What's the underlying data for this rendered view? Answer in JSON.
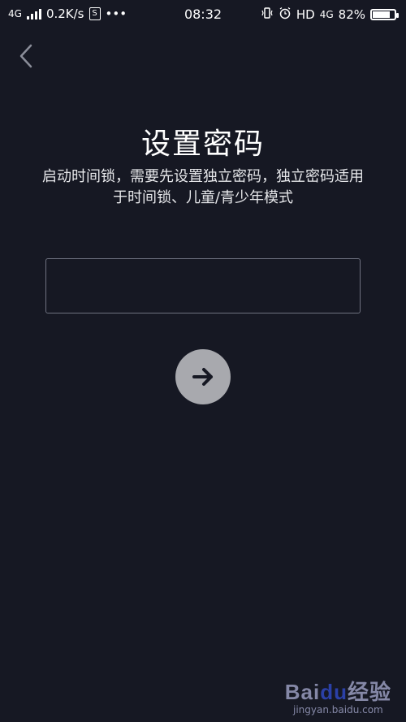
{
  "status_bar": {
    "network_type": "4G",
    "speed": "0.2K/s",
    "sim_label": "S",
    "more": "•••",
    "time": "08:32",
    "hd": "HD",
    "network_type_right": "4G",
    "battery_percent": "82%",
    "battery_level": 0.82
  },
  "page": {
    "title": "设置密码",
    "subtitle": "启动时间锁，需要先设置独立密码，独立密码适用于时间锁、儿童/青少年模式",
    "input_value": "",
    "input_placeholder": ""
  },
  "icons": {
    "back": "chevron-left-icon",
    "next": "arrow-right-icon",
    "vibrate": "vibrate-icon",
    "alarm": "alarm-icon"
  },
  "watermark": {
    "brand_part1": "Bai",
    "brand_paw": "du",
    "brand_part2": "经验",
    "url": "jingyan.baidu.com"
  },
  "colors": {
    "background": "#161823",
    "input_border": "#6f7280",
    "next_button": "#a8a9ae"
  }
}
